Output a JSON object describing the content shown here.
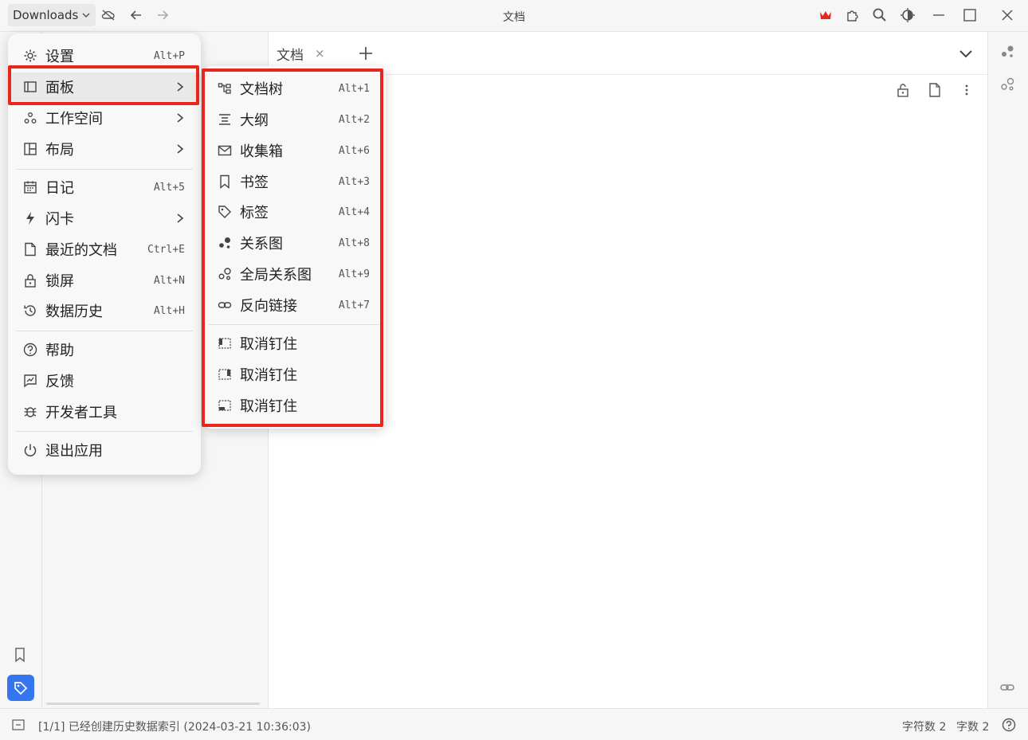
{
  "titlebar": {
    "workspace": "Downloads",
    "title": "文档",
    "icons": [
      "cloud-off-icon",
      "arrow-left-icon",
      "arrow-right-icon",
      "crown-icon",
      "plugin-icon",
      "search-icon",
      "theme-icon",
      "minimize-icon",
      "maximize-icon",
      "close-icon"
    ]
  },
  "editor": {
    "tab_label": "文档",
    "tab_close": "×"
  },
  "main_menu": {
    "groups": [
      [
        {
          "label": "设置",
          "shortcut": "Alt+P",
          "icon": "gear-icon"
        },
        {
          "label": "面板",
          "shortcut": "",
          "icon": "panel-icon",
          "submenu": true
        },
        {
          "label": "工作空间",
          "shortcut": "",
          "icon": "workspace-icon",
          "submenu": true
        },
        {
          "label": "布局",
          "shortcut": "",
          "icon": "layout-icon",
          "submenu": true
        }
      ],
      [
        {
          "label": "日记",
          "shortcut": "Alt+5",
          "icon": "calendar-icon"
        },
        {
          "label": "闪卡",
          "shortcut": "",
          "icon": "flash-icon",
          "submenu": true
        },
        {
          "label": "最近的文档",
          "shortcut": "Ctrl+E",
          "icon": "file-icon"
        },
        {
          "label": "锁屏",
          "shortcut": "Alt+N",
          "icon": "lock-icon"
        },
        {
          "label": "数据历史",
          "shortcut": "Alt+H",
          "icon": "history-icon"
        }
      ],
      [
        {
          "label": "帮助",
          "shortcut": "",
          "icon": "help-icon"
        },
        {
          "label": "反馈",
          "shortcut": "",
          "icon": "feedback-icon"
        },
        {
          "label": "开发者工具",
          "shortcut": "",
          "icon": "bug-icon"
        }
      ],
      [
        {
          "label": "退出应用",
          "shortcut": "",
          "icon": "power-icon"
        }
      ]
    ]
  },
  "sub_menu": {
    "groups": [
      [
        {
          "label": "文档树",
          "shortcut": "Alt+1",
          "icon": "doc-tree-icon"
        },
        {
          "label": "大纲",
          "shortcut": "Alt+2",
          "icon": "outline-icon"
        },
        {
          "label": "收集箱",
          "shortcut": "Alt+6",
          "icon": "inbox-icon"
        },
        {
          "label": "书签",
          "shortcut": "Alt+3",
          "icon": "bookmark-icon"
        },
        {
          "label": "标签",
          "shortcut": "Alt+4",
          "icon": "tag-icon"
        },
        {
          "label": "关系图",
          "shortcut": "Alt+8",
          "icon": "graph-icon"
        },
        {
          "label": "全局关系图",
          "shortcut": "Alt+9",
          "icon": "global-graph-icon"
        },
        {
          "label": "反向链接",
          "shortcut": "Alt+7",
          "icon": "backlink-icon"
        }
      ],
      [
        {
          "label": "取消钉住",
          "shortcut": "",
          "icon": "unpin-left-icon"
        },
        {
          "label": "取消钉住",
          "shortcut": "",
          "icon": "unpin-right-icon"
        },
        {
          "label": "取消钉住",
          "shortcut": "",
          "icon": "unpin-bottom-icon"
        }
      ]
    ]
  },
  "statusbar": {
    "message": "[1/1] 已经创建历史数据索引 (2024-03-21 10:36:03)",
    "char_count": "字符数 2",
    "word_count": "字数 2"
  },
  "colors": {
    "highlight": "#e8261c",
    "accent": "#3575f0"
  }
}
